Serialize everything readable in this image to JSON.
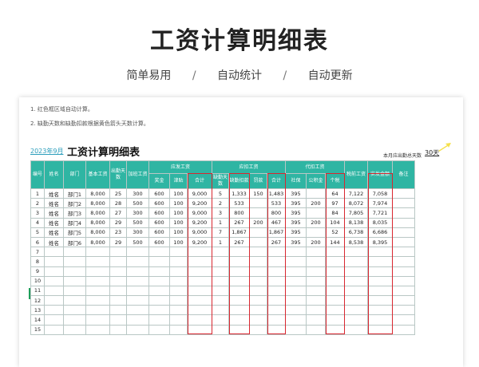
{
  "hero": {
    "title": "工资计算明细表",
    "features": [
      "简单易用",
      "自动统计",
      "自动更新"
    ],
    "separator": "/"
  },
  "notes": [
    "1. 红色框区域自动计算。",
    "2. 缺勤天数和缺勤扣款根据黄色箭头天数计算。"
  ],
  "sheet": {
    "date_label": "2023年9月",
    "title": "工资计算明细表",
    "days_label": "本月应出勤总天数",
    "days_value": "30天",
    "accent_color": "#2fb5a3",
    "highlight_color": "#d8262f",
    "arrow_color": "#f5e04a"
  },
  "headers": {
    "no": "编号",
    "name": "姓名",
    "dept": "部门",
    "base": "基本工资",
    "attend": "出勤天数",
    "overtime": "加班工资",
    "pay_group": "应发工资",
    "bonus": "奖金",
    "allowance": "津贴",
    "pay_total": "合计",
    "deduct_group": "应扣工资",
    "absent_days": "缺勤天数",
    "absent_deduct": "缺勤扣款",
    "fine": "罚款",
    "deduct_total": "合计",
    "withhold_group": "代扣工资",
    "social": "社保",
    "fund": "公积金",
    "tax": "个税",
    "taxable": "税前工资",
    "net": "实发金额",
    "remark": "备注"
  },
  "rows": [
    {
      "no": "1",
      "name": "姓名",
      "dept": "部门1",
      "base": "8,000",
      "attend": "25",
      "overtime": "300",
      "bonus": "600",
      "allowance": "100",
      "pay_total": "9,000",
      "absent_days": "5",
      "absent_deduct": "1,333",
      "fine": "150",
      "deduct_total": "1,483",
      "social": "395",
      "fund": "",
      "tax": "64",
      "taxable": "7,122",
      "net": "7,058",
      "remark": ""
    },
    {
      "no": "2",
      "name": "姓名",
      "dept": "部门2",
      "base": "8,000",
      "attend": "28",
      "overtime": "500",
      "bonus": "600",
      "allowance": "100",
      "pay_total": "9,200",
      "absent_days": "2",
      "absent_deduct": "533",
      "fine": "",
      "deduct_total": "533",
      "social": "395",
      "fund": "200",
      "tax": "97",
      "taxable": "8,072",
      "net": "7,974",
      "remark": ""
    },
    {
      "no": "3",
      "name": "姓名",
      "dept": "部门3",
      "base": "8,000",
      "attend": "27",
      "overtime": "300",
      "bonus": "600",
      "allowance": "100",
      "pay_total": "9,000",
      "absent_days": "3",
      "absent_deduct": "800",
      "fine": "",
      "deduct_total": "800",
      "social": "395",
      "fund": "",
      "tax": "84",
      "taxable": "7,805",
      "net": "7,721",
      "remark": ""
    },
    {
      "no": "4",
      "name": "姓名",
      "dept": "部门4",
      "base": "8,000",
      "attend": "29",
      "overtime": "500",
      "bonus": "600",
      "allowance": "100",
      "pay_total": "9,200",
      "absent_days": "1",
      "absent_deduct": "267",
      "fine": "200",
      "deduct_total": "467",
      "social": "395",
      "fund": "200",
      "tax": "104",
      "taxable": "8,138",
      "net": "8,035",
      "remark": ""
    },
    {
      "no": "5",
      "name": "姓名",
      "dept": "部门5",
      "base": "8,000",
      "attend": "23",
      "overtime": "300",
      "bonus": "600",
      "allowance": "100",
      "pay_total": "9,000",
      "absent_days": "7",
      "absent_deduct": "1,867",
      "fine": "",
      "deduct_total": "1,867",
      "social": "395",
      "fund": "",
      "tax": "52",
      "taxable": "6,738",
      "net": "6,686",
      "remark": ""
    },
    {
      "no": "6",
      "name": "姓名",
      "dept": "部门6",
      "base": "8,000",
      "attend": "29",
      "overtime": "500",
      "bonus": "600",
      "allowance": "100",
      "pay_total": "9,200",
      "absent_days": "1",
      "absent_deduct": "267",
      "fine": "",
      "deduct_total": "267",
      "social": "395",
      "fund": "200",
      "tax": "144",
      "taxable": "8,538",
      "net": "8,395",
      "remark": ""
    }
  ],
  "empty_rows": [
    "7",
    "8",
    "9",
    "10",
    "11",
    "12",
    "13",
    "14",
    "15"
  ]
}
